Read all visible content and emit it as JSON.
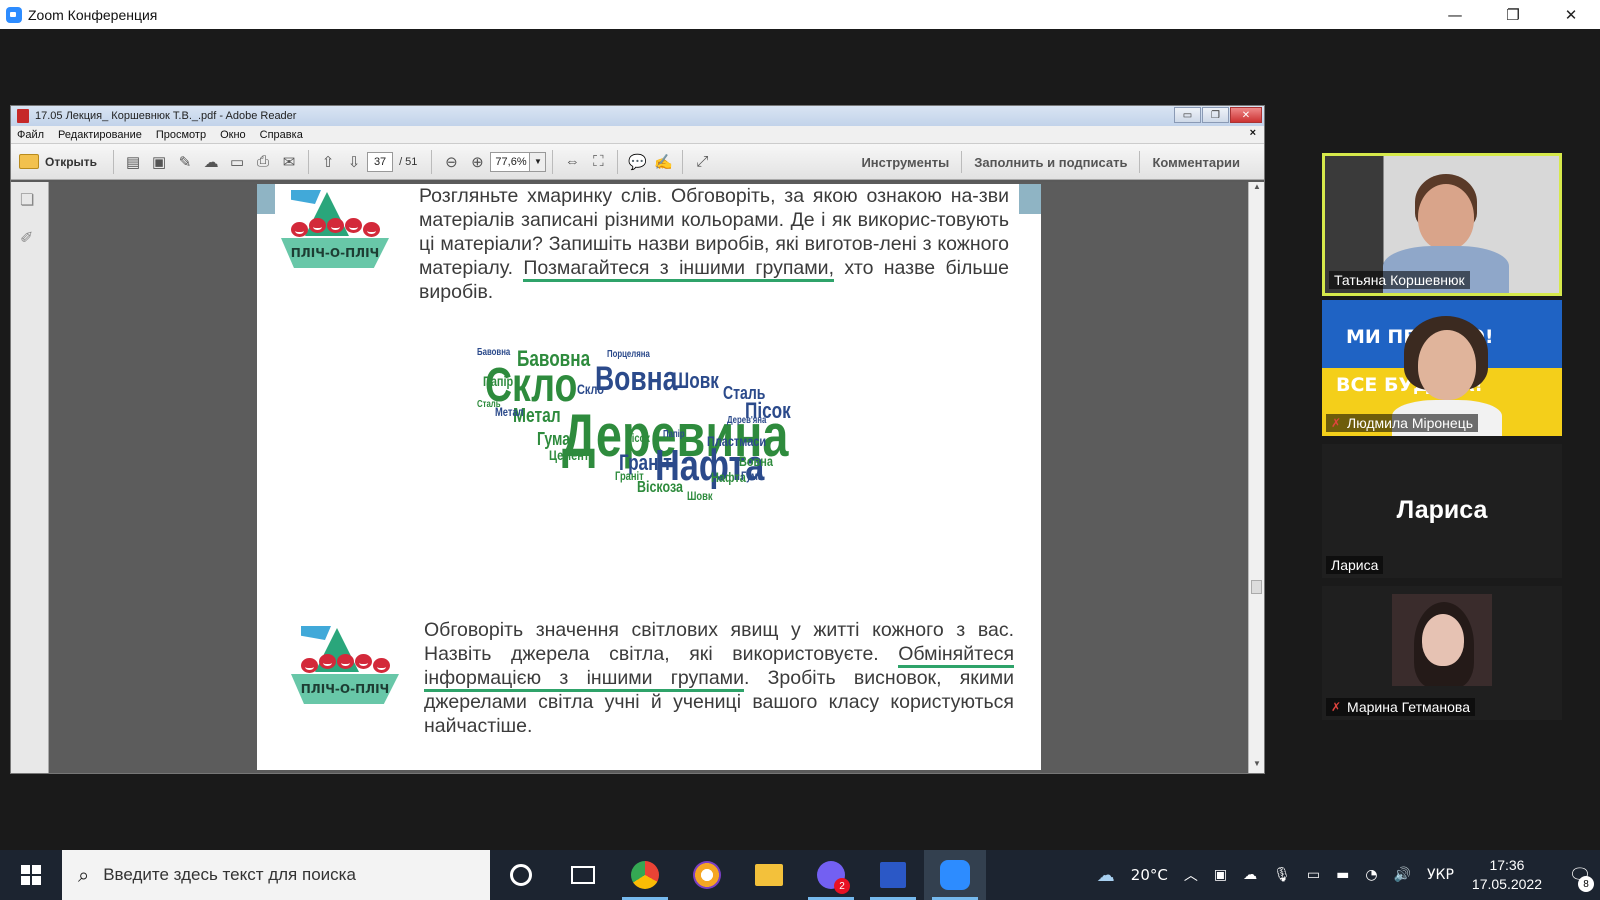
{
  "zoom": {
    "title": "Zoom Конференция",
    "minimize": "—",
    "restore": "❐",
    "close": "✕"
  },
  "reader": {
    "title": "17.05 Лекция_ Коршевнюк Т.В._.pdf - Adobe Reader",
    "menu": [
      "Файл",
      "Редактирование",
      "Просмотр",
      "Окно",
      "Справка"
    ],
    "menu_close": "×",
    "toolbar": {
      "open_label": "Открыть",
      "page_current": "37",
      "page_total": "/ 51",
      "zoom_value": "77,6%",
      "tools": "Инструменты",
      "fill_sign": "Заполнить и подписать",
      "comments": "Комментарии"
    }
  },
  "page": {
    "logo_label": "ПЛІЧ-О-ПЛІЧ",
    "para1_a": "Розгляньте хмаринку слів. Обговоріть, за якою ознакою на-зви матеріалів записані різними кольорами. Де і як викорис-товують ці матеріали? Запишіть назви виробів, які виготов-лені з кожного матеріалу. ",
    "para1_u": "Позмагайтеся з іншими групами,",
    "para1_b": " хто назве більше виробів.",
    "para2_a": "Обговоріть значення світлових явищ у житті кожного з вас. Назвіть джерела світла, які використовуєте. ",
    "para2_u": "Обміняйтеся інформацією з іншими групами",
    "para2_b": ". Зробіть висновок, якими джерелами світла учні й учениці вашого класу користуються найчастіше.",
    "wordcloud": [
      {
        "t": "Деревина",
        "c": "#2e8b3d"
      },
      {
        "t": "Скло",
        "c": "#2e8b3d"
      },
      {
        "t": "Нафта",
        "c": "#2b4a8b"
      },
      {
        "t": "Вовна",
        "c": "#2b4a8b"
      },
      {
        "t": "Шовк",
        "c": "#2b4a8b"
      },
      {
        "t": "Сталь",
        "c": "#2b4a8b"
      },
      {
        "t": "Пісок",
        "c": "#2b4a8b"
      },
      {
        "t": "Метал",
        "c": "#2e8b3d"
      },
      {
        "t": "Бавовна",
        "c": "#2e8b3d"
      },
      {
        "t": "Граніт",
        "c": "#2b4a8b"
      },
      {
        "t": "Віскоза",
        "c": "#2e8b3d"
      },
      {
        "t": "Гума",
        "c": "#2e8b3d"
      },
      {
        "t": "Цемент",
        "c": "#2e8b3d"
      },
      {
        "t": "Пластмаси",
        "c": "#2b4a8b"
      },
      {
        "t": "Папір",
        "c": "#2e8b3d"
      },
      {
        "t": "Скло",
        "c": "#2b4a8b"
      },
      {
        "t": "Вовна",
        "c": "#2e8b3d"
      },
      {
        "t": "Нафта",
        "c": "#2e8b3d"
      },
      {
        "t": "Гума",
        "c": "#2b4a8b"
      },
      {
        "t": "Порцеляна",
        "c": "#2b4a8b"
      },
      {
        "t": "Дерев'яна",
        "c": "#2b4a8b"
      },
      {
        "t": "Сталь",
        "c": "#2e8b3d"
      },
      {
        "t": "Метал",
        "c": "#2b4a8b"
      },
      {
        "t": "Бавовна",
        "c": "#2b4a8b"
      },
      {
        "t": "Пісок",
        "c": "#2e8b3d"
      },
      {
        "t": "Папір",
        "c": "#2b4a8b"
      },
      {
        "t": "Граніт",
        "c": "#2e8b3d"
      },
      {
        "t": "Шовк",
        "c": "#2e8b3d"
      }
    ]
  },
  "participants": [
    {
      "name": "Татьяна Коршевнюк",
      "muted": false,
      "active": true
    },
    {
      "name": "Людмила Міронець",
      "muted": true,
      "banner_top": "МИ ПЕР    ЕМО!",
      "banner_bottom": "ВСЕ БУД    ЇНА!"
    },
    {
      "name": "Лариса",
      "display": "Лариса",
      "muted": false
    },
    {
      "name": "Марина Гетманова",
      "muted": true
    }
  ],
  "taskbar": {
    "search_placeholder": "Введите здесь текст для поиска",
    "badge_viber": "2",
    "weather": "20°C",
    "lang": "УКР",
    "time": "17:36",
    "date": "17.05.2022",
    "notif_count": "8"
  }
}
